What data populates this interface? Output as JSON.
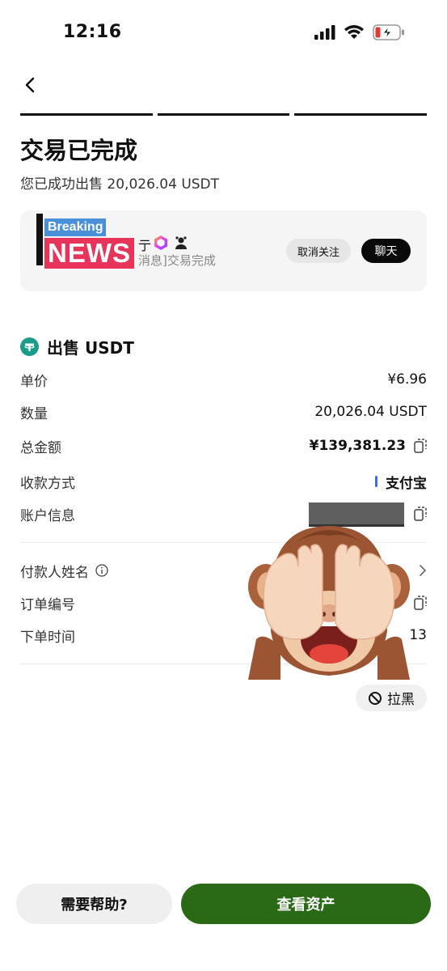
{
  "status_bar": {
    "time": "12:16",
    "icons": [
      "signal-icon",
      "wifi-icon",
      "battery-charging-icon"
    ],
    "battery_color": "#e53935"
  },
  "nav": {
    "back_icon": "chevron-left-icon"
  },
  "progress_steps": 3,
  "header": {
    "title": "交易已完成",
    "subtitle": "您已成功出售 20,026.04 USDT"
  },
  "merchant": {
    "avatar_text_top": "Breaking",
    "avatar_text_main": "NEWS",
    "name_fragment": "亍",
    "message_preview": "消息]交易完成",
    "unfollow_label": "取消关注",
    "chat_label": "聊天"
  },
  "order": {
    "title": "出售 USDT",
    "accent_color": "#1a9c8c",
    "rows": [
      {
        "label": "单价",
        "value": "¥6.96"
      },
      {
        "label": "数量",
        "value": "20,026.04 USDT"
      },
      {
        "label": "总金额",
        "value": "¥139,381.23"
      },
      {
        "label": "收款方式",
        "value": "支付宝"
      },
      {
        "label": "账户信息",
        "value": ""
      }
    ],
    "rows2": [
      {
        "label": "付款人姓名",
        "value": ""
      },
      {
        "label": "订单编号",
        "value": ""
      },
      {
        "label": "下单时间",
        "value": "13"
      }
    ]
  },
  "block_label": "拉黑",
  "footer": {
    "help_label": "需要帮助?",
    "assets_label": "查看资产",
    "assets_color": "#2a6a17"
  }
}
